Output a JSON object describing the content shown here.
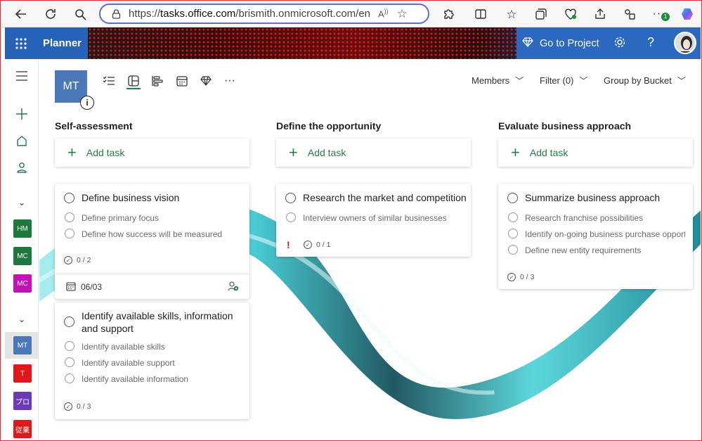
{
  "browser": {
    "url_prefix": "https://",
    "url_host": "tasks.office.com",
    "url_path": "/brismith.onmicrosoft.com/en-US/",
    "profile_badge": "1"
  },
  "appbar": {
    "app_name": "Planner",
    "go_to_project": "Go to Project",
    "help": "?"
  },
  "rail": {
    "plans_recent": [
      {
        "abbr": "HM",
        "color": "#1e7a3c"
      },
      {
        "abbr": "MC",
        "color": "#1e7a3c"
      },
      {
        "abbr": "MC",
        "color": "#c410b8"
      }
    ],
    "plans_pinned": [
      {
        "abbr": "MT",
        "color": "#4b78b8"
      },
      {
        "abbr": "T",
        "color": "#e0181b"
      },
      {
        "abbr": "プロ",
        "color": "#6b3ab8"
      },
      {
        "abbr": "従業",
        "color": "#e0181b"
      }
    ]
  },
  "plan": {
    "abbr": "MT",
    "info": "i"
  },
  "controls": {
    "members": "Members",
    "filter": "Filter (0)",
    "group_by": "Group by Bucket"
  },
  "add_task_label": "Add task",
  "buckets": [
    {
      "name": "Self-assessment",
      "cards": [
        {
          "title": "Define business vision",
          "subtasks": [
            "Define primary focus",
            "Define how success will be measured"
          ],
          "progress": "0 / 2",
          "due": "06/03"
        },
        {
          "title": "Identify available skills, information and support",
          "subtasks": [
            "Identify available skills",
            "Identify available support",
            "Identify available information"
          ],
          "progress": "0 / 3"
        }
      ]
    },
    {
      "name": "Define the opportunity",
      "cards": [
        {
          "title": "Research the market and competition",
          "subtasks": [
            "Interview owners of similar businesses"
          ],
          "progress": "0 / 1",
          "priority": "!"
        }
      ]
    },
    {
      "name": "Evaluate business approach",
      "cards": [
        {
          "title": "Summarize business approach",
          "subtasks": [
            "Research franchise possibilities",
            "Identify on-going business purchase opportu",
            "Define new entity requirements"
          ],
          "progress": "0 / 3"
        }
      ]
    }
  ],
  "colors": {
    "brand_blue": "#2562b8",
    "accent_green": "#2b7a4a",
    "priority_red": "#c4161c"
  }
}
